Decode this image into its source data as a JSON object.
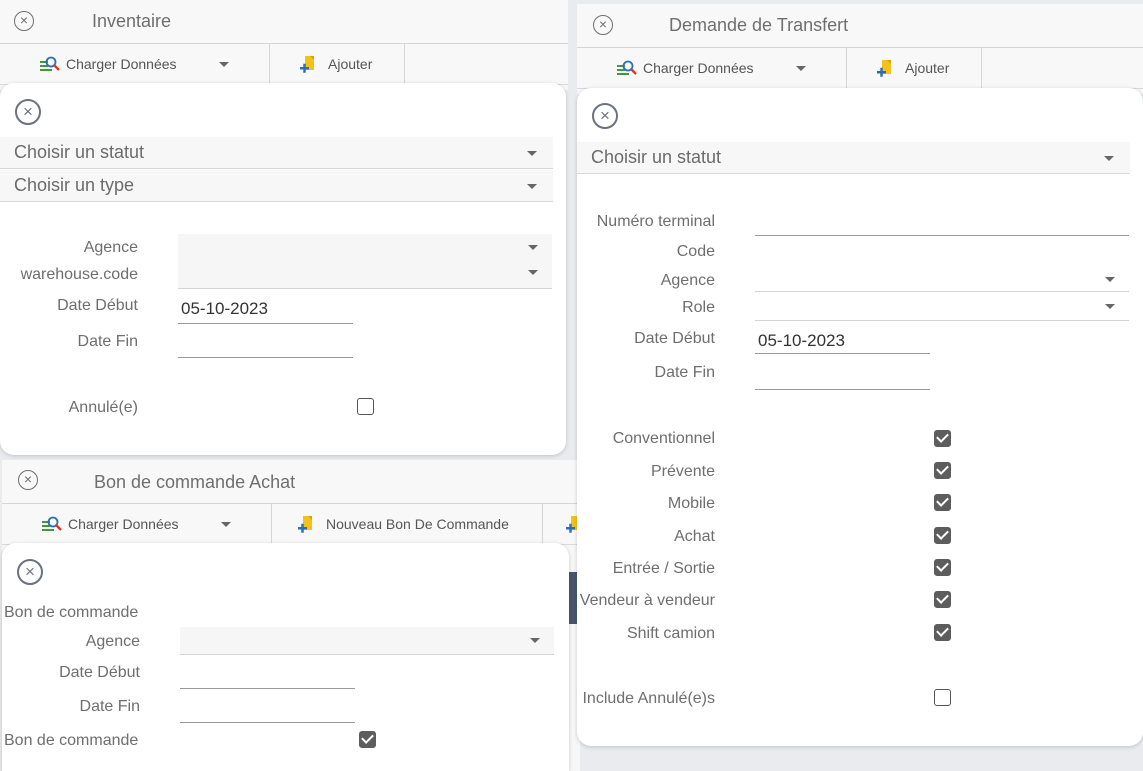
{
  "inventaire": {
    "title": "Inventaire",
    "load_label": "Charger Données",
    "add_label": "Ajouter",
    "filter": {
      "status_placeholder": "Choisir un statut",
      "type_placeholder": "Choisir un type",
      "agence_label": "Agence",
      "warehouse_label": "warehouse.code",
      "date_debut_label": "Date Début",
      "date_debut_value": "05-10-2023",
      "date_fin_label": "Date Fin",
      "annule_label": "Annulé(e)",
      "annule_checked": false
    }
  },
  "transfert": {
    "title": "Demande de Transfert",
    "load_label": "Charger Données",
    "add_label": "Ajouter",
    "filter": {
      "status_placeholder": "Choisir un statut",
      "numero_terminal_label": "Numéro terminal",
      "code_label": "Code",
      "agence_label": "Agence",
      "role_label": "Role",
      "date_debut_label": "Date Début",
      "date_debut_value": "05-10-2023",
      "date_fin_label": "Date Fin",
      "checkboxes": [
        {
          "label": "Conventionnel",
          "checked": true
        },
        {
          "label": "Prévente",
          "checked": true
        },
        {
          "label": "Mobile",
          "checked": true
        },
        {
          "label": "Achat",
          "checked": true
        },
        {
          "label": "Entrée / Sortie",
          "checked": true
        },
        {
          "label": "Vendeur à vendeur",
          "checked": true
        },
        {
          "label": "Shift camion",
          "checked": true
        }
      ],
      "include_annule_label": "Include Annulé(e)s",
      "include_annule_checked": false
    }
  },
  "bon_commande": {
    "title": "Bon de commande Achat",
    "load_label": "Charger Données",
    "new_label": "Nouveau Bon De Commande",
    "filter": {
      "bon_commande_label": "Bon de commande",
      "agence_label": "Agence",
      "date_debut_label": "Date Début",
      "date_fin_label": "Date Fin",
      "bon_commande_check_label": "Bon de commande",
      "bon_commande_checked": true
    }
  },
  "colors": {
    "accent_dark": "#4a5670",
    "icon_green": "#3f9a3f",
    "icon_red": "#d43a2a",
    "icon_yellow": "#f3c21a",
    "icon_blue": "#2d6fb7"
  }
}
